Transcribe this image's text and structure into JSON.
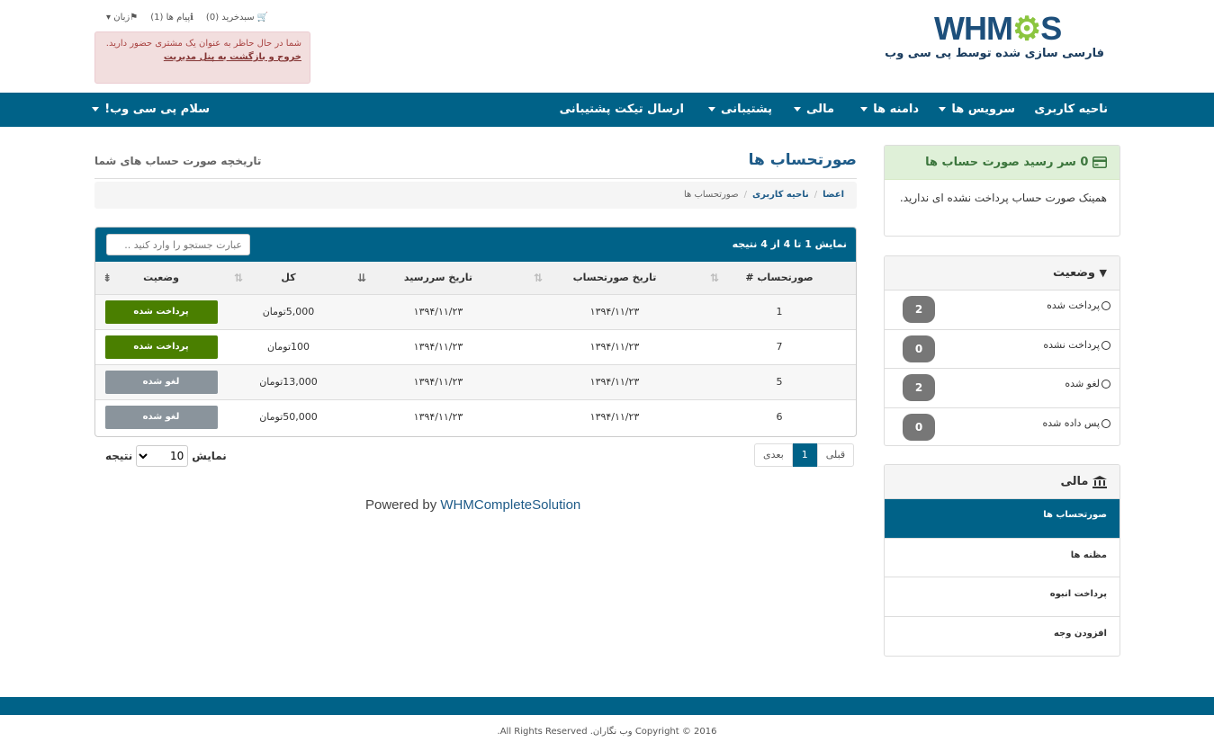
{
  "brand": {
    "logo_text_a": "WHM",
    "logo_text_b": "S",
    "tagline": "فارسی سازی شده توسط پی سی وب"
  },
  "topbar": {
    "cart": "سبدخرید (0)",
    "messages": "پیام ها (1)",
    "language": "زبان"
  },
  "alert": {
    "text": "شما در حال حاظر به عنوان یک مشتری حضور دارید.",
    "link": "خروج و بازگشت به پنل مدیریت"
  },
  "nav": {
    "home": "ناحیه کاربری",
    "services": "سرویس ها",
    "domains": "دامنه ها",
    "billing": "مالی",
    "support": "پشتیبانی",
    "open_ticket": "ارسال تیکت پشتیبانی",
    "account": "سلام پی سی وب!"
  },
  "page": {
    "title": "صورتحساب ها",
    "subtitle": "تاریخچه صورت حساب های شما"
  },
  "breadcrumb": {
    "items": [
      "اعضا",
      "ناحیه کاربری",
      "صورتحساب ها"
    ]
  },
  "table": {
    "info": "نمایش 1 تا 4 از 4 نتیجه",
    "search_placeholder": "عبارت جستجو را وارد کنید ..",
    "columns": [
      "صورتحساب #",
      "تاریخ صورتحساب",
      "تاریخ سررسید",
      "کل",
      "وضعیت"
    ],
    "rows": [
      {
        "id": "1",
        "date": "۱۳۹۴/۱۱/۲۳",
        "due": "۱۳۹۴/۱۱/۲۳",
        "total": "5,000تومان",
        "status": "پرداخت شده",
        "status_color": "#4a7f00"
      },
      {
        "id": "7",
        "date": "۱۳۹۴/۱۱/۲۳",
        "due": "۱۳۹۴/۱۱/۲۳",
        "total": "100تومان",
        "status": "پرداخت شده",
        "status_color": "#4a7f00"
      },
      {
        "id": "5",
        "date": "۱۳۹۴/۱۱/۲۳",
        "due": "۱۳۹۴/۱۱/۲۳",
        "total": "13,000تومان",
        "status": "لغو شده",
        "status_color": "#8a949c"
      },
      {
        "id": "6",
        "date": "۱۳۹۴/۱۱/۲۳",
        "due": "۱۳۹۴/۱۱/۲۳",
        "total": "50,000تومان",
        "status": "لغو شده",
        "status_color": "#8a949c"
      }
    ]
  },
  "pagination": {
    "prev": "قبلی",
    "current": "1",
    "next": "بعدی"
  },
  "length": {
    "label_show": "نمایش",
    "value": "10",
    "label_results": "نتیجه"
  },
  "powered": {
    "prefix": "Powered by ",
    "brand": "WHMCompleteSolution"
  },
  "sidebar": {
    "due": {
      "title": "0 سر رسید صورت حساب ها",
      "body": "همینک صورت حساب پرداخت نشده ای ندارید."
    },
    "status": {
      "title": "وضعیت",
      "items": [
        {
          "label": "پرداخت شده",
          "count": "2"
        },
        {
          "label": "پرداخت نشده",
          "count": "0"
        },
        {
          "label": "لغو شده",
          "count": "2"
        },
        {
          "label": "پس داده شده",
          "count": "0"
        }
      ]
    },
    "billing": {
      "title": "مالی",
      "items": [
        "صورتحساب ها",
        "مظنه ها",
        "پرداخت انبوه",
        "افزودن وجه"
      ]
    }
  },
  "footer": {
    "copyright": "Copyright © 2016 وب نگاران. All Rights Reserved."
  },
  "colors": {
    "primary": "#006288",
    "paid": "#4a7f00",
    "cancelled": "#8a949c"
  }
}
